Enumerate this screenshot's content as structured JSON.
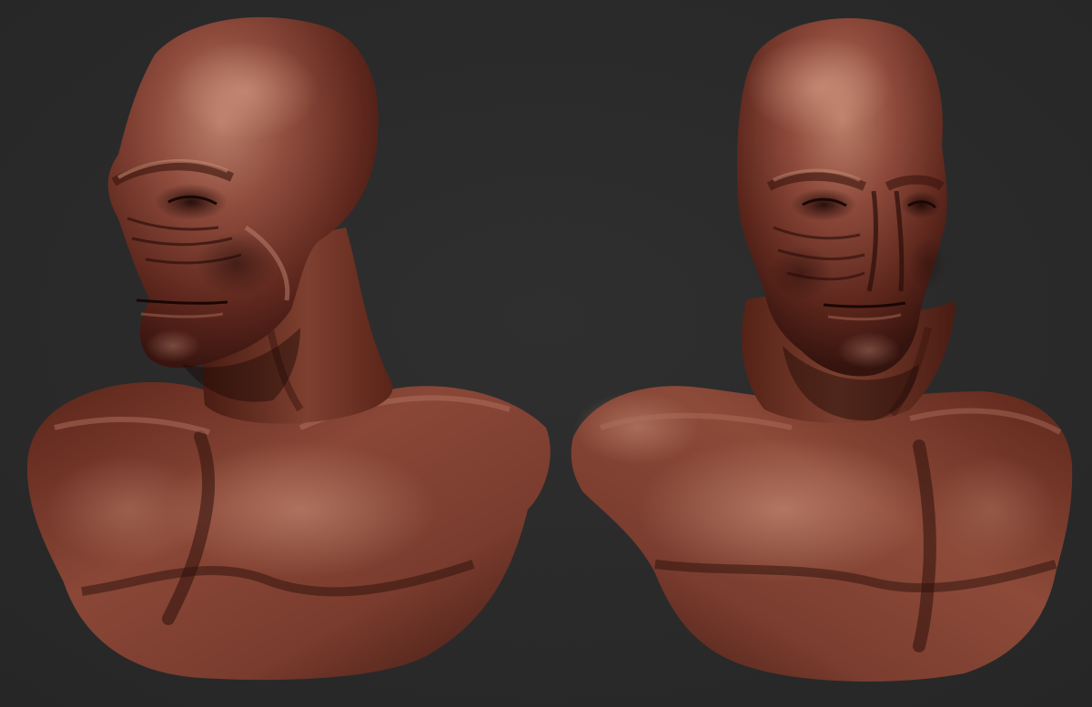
{
  "scene": {
    "background_color": "#2b2b2b",
    "clay_base_color": "#6e3327",
    "clay_highlight_color": "#b67a66",
    "clay_shadow_color": "#2c0f0b",
    "views": [
      {
        "name": "three-quarter-left"
      },
      {
        "name": "three-quarter-right"
      }
    ]
  }
}
